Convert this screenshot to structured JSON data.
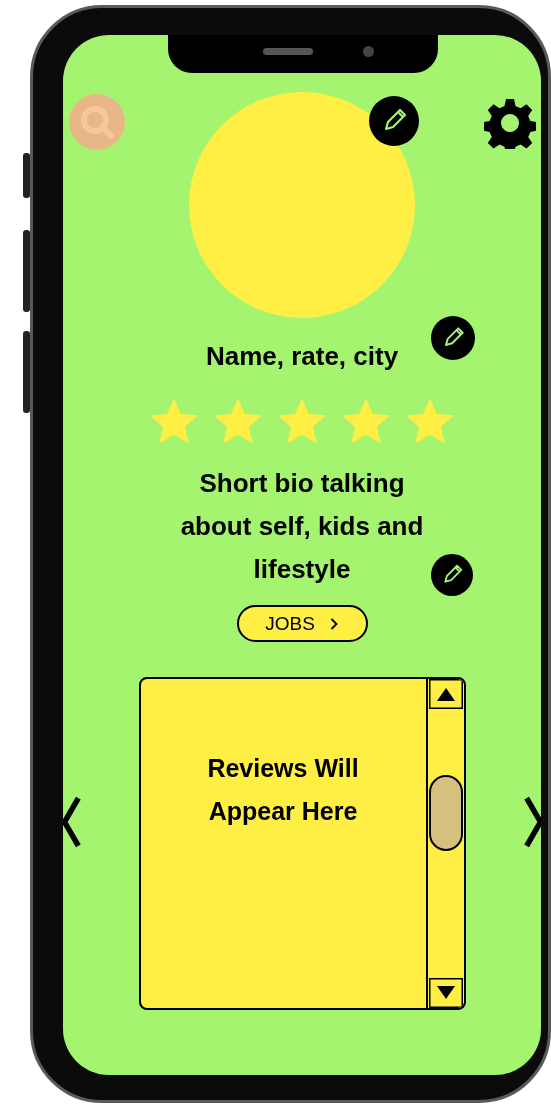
{
  "profile": {
    "name": "Name, rate, city",
    "stars": 5,
    "bio": "Short bio talking about self, kids and lifestyle"
  },
  "jobs_button": {
    "label": "JOBS"
  },
  "reviews": {
    "placeholder": "Reviews Will Appear Here"
  }
}
